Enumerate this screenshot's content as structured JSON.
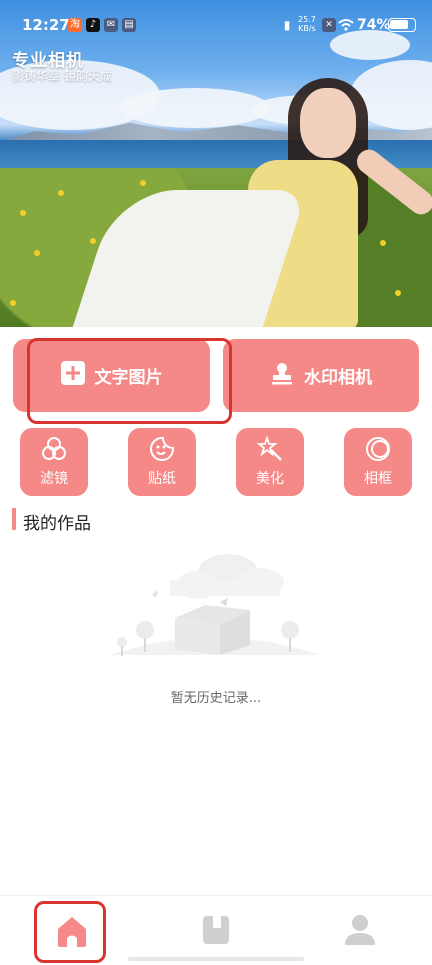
{
  "status_bar": {
    "time": "12:27",
    "net_speed_top": "25.7",
    "net_speed_unit": "KB/s",
    "battery": "74%"
  },
  "hero": {
    "title": "专业相机",
    "subtitle": "影铸华章 镜韵天成"
  },
  "actions": {
    "text_image": "文字图片",
    "watermark_camera": "水印相机"
  },
  "tools": [
    {
      "label": "滤镜",
      "icon": "filter-circles-icon"
    },
    {
      "label": "贴纸",
      "icon": "sticker-icon"
    },
    {
      "label": "美化",
      "icon": "magic-wand-icon"
    },
    {
      "label": "相框",
      "icon": "frame-icon"
    }
  ],
  "works": {
    "title": "我的作品",
    "empty_text": "暂无历史记录..."
  },
  "nav": {
    "items": [
      "home-icon",
      "book-icon",
      "profile-icon"
    ],
    "active": "home-icon"
  },
  "colors": {
    "accent": "#f58987",
    "highlight_box": "#d8352f",
    "nav_inactive": "#cfcfcf"
  }
}
